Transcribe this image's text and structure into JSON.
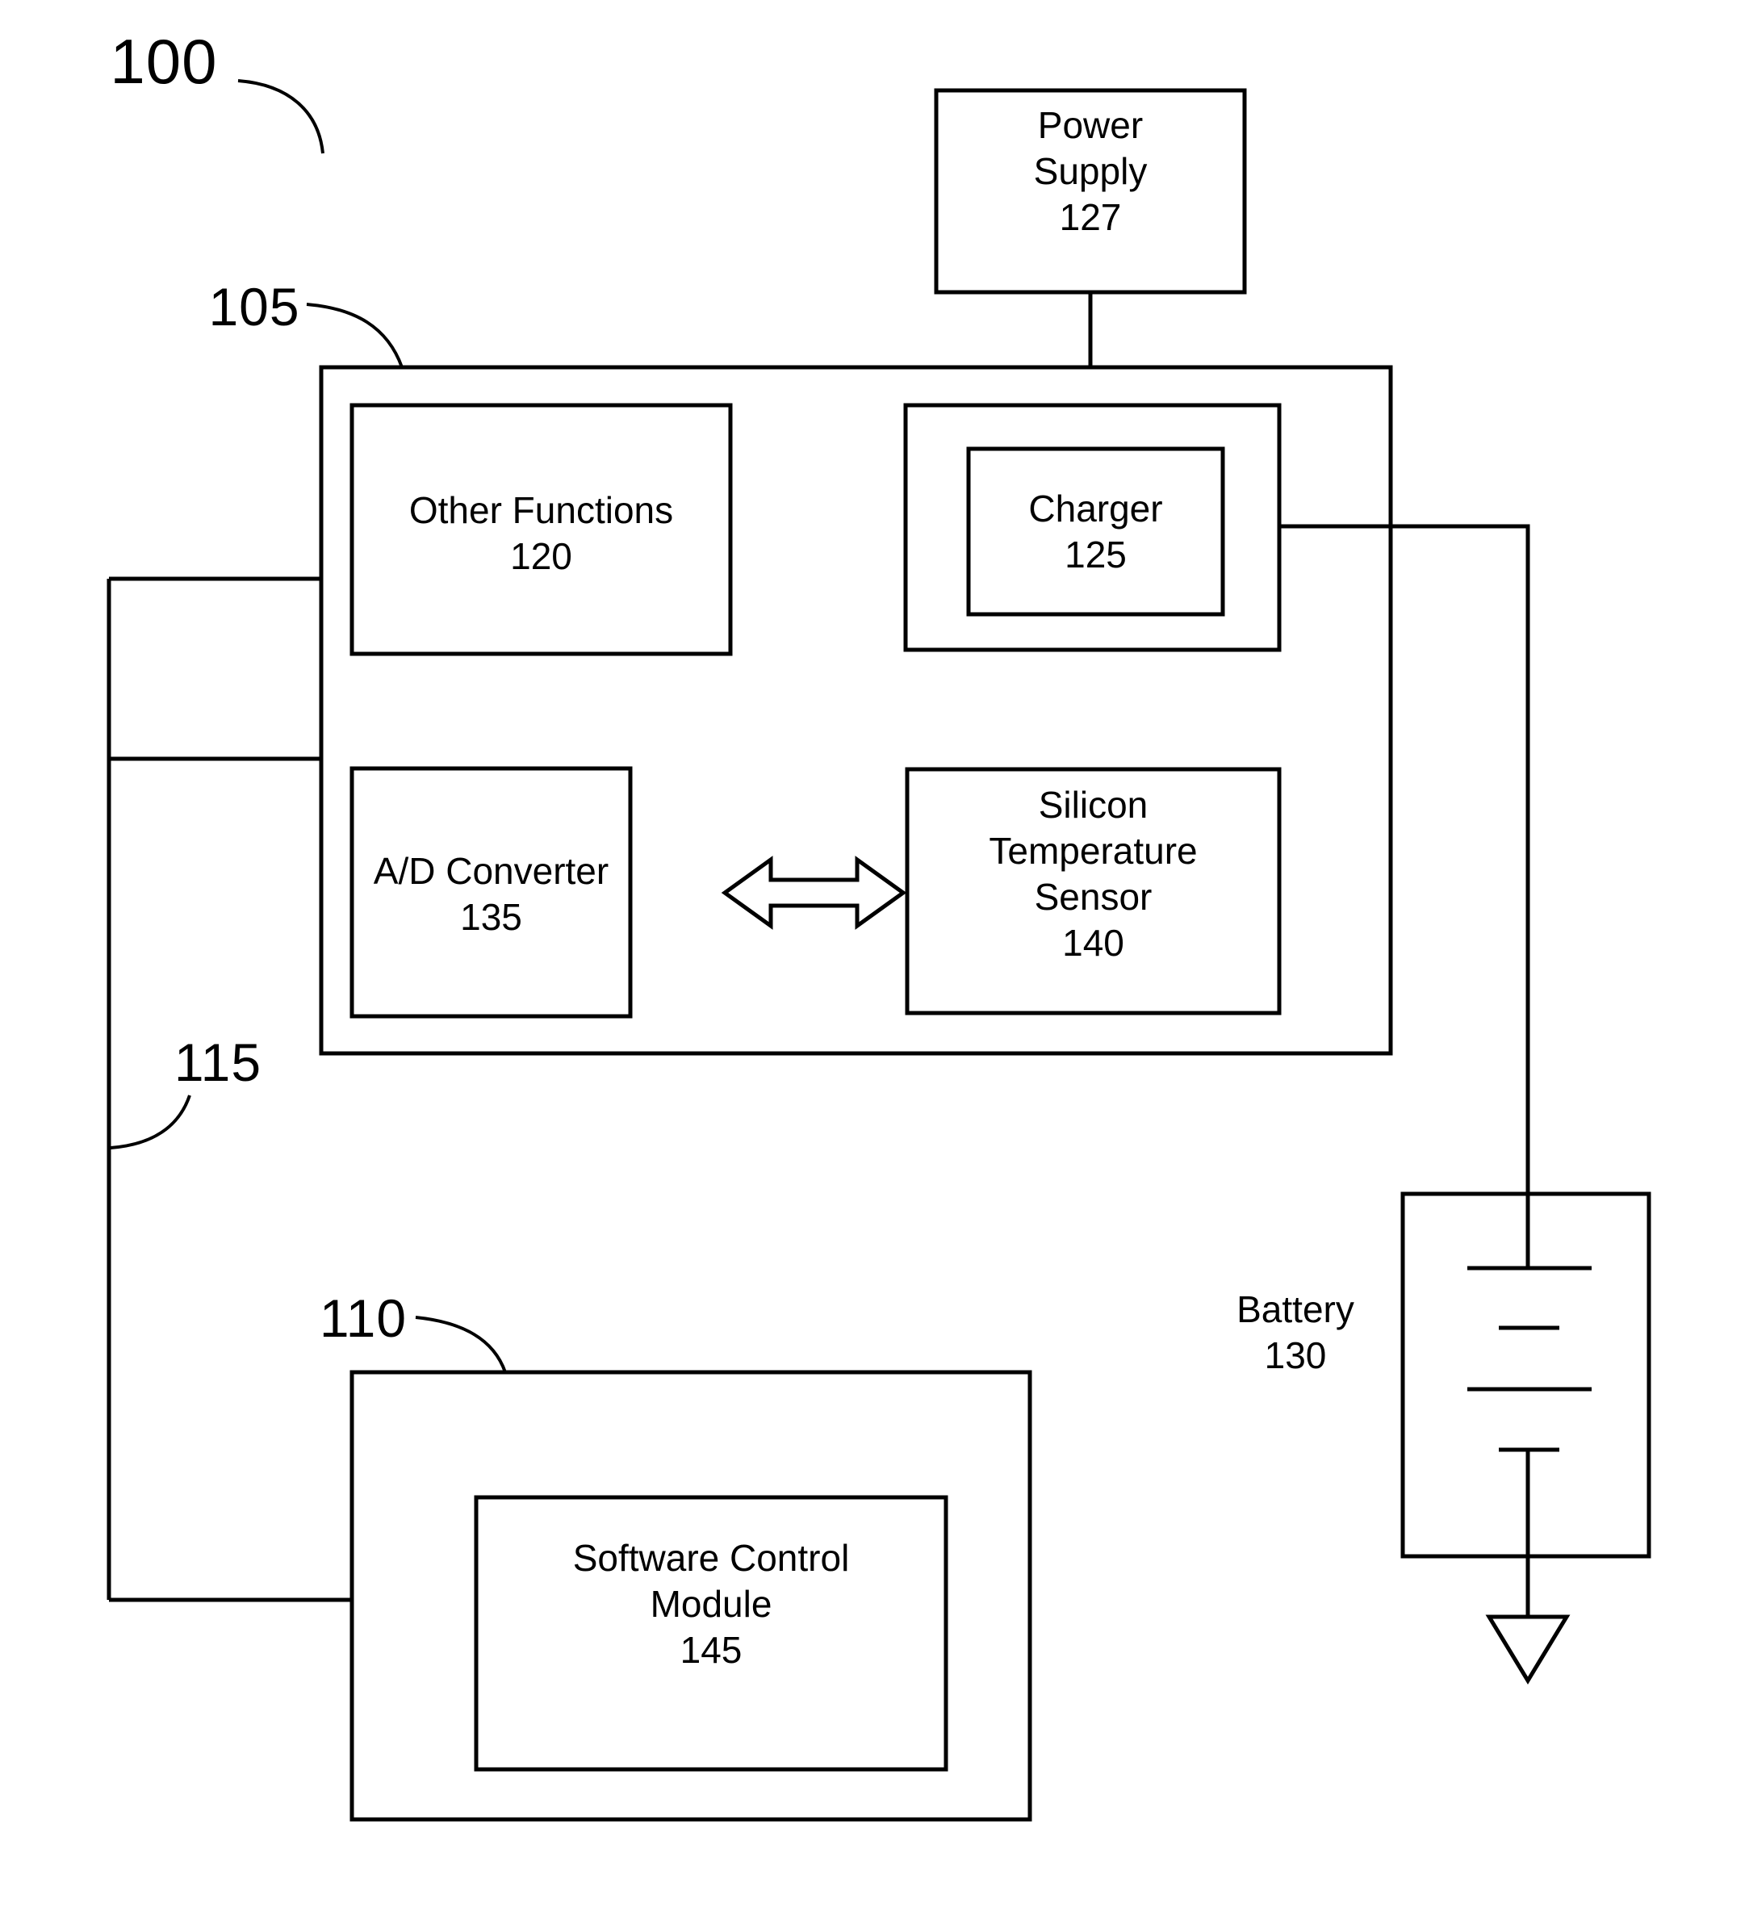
{
  "figure": {
    "type": "patent-block-diagram",
    "reference_numerals": {
      "system": "100",
      "device": "105",
      "host": "110",
      "bus": "115"
    }
  },
  "labels": {
    "system_100": "100",
    "device_105": "105",
    "host_110": "110",
    "bus_115": "115"
  },
  "blocks": {
    "power_supply": {
      "title": "Power\nSupply",
      "numeral": "127",
      "line1": "Power",
      "line2": "Supply",
      "line3": "127"
    },
    "other_functions": {
      "line1": "Other Functions",
      "line2": "120"
    },
    "charger": {
      "line1": "Charger",
      "line2": "125"
    },
    "ad_converter": {
      "line1": "A/D Converter",
      "line2": "135"
    },
    "temperature_sensor": {
      "line1": "Silicon",
      "line2": "Temperature",
      "line3": "Sensor",
      "line4": "140"
    },
    "software_control_module": {
      "line1": "Software Control",
      "line2": "Module",
      "line3": "145"
    },
    "battery": {
      "line1": "Battery",
      "line2": "130"
    }
  },
  "symbols": {
    "battery_cell": "battery-cell-symbol",
    "ground": "ground-triangle-symbol",
    "bidirectional_arrow": "double-headed-arrow"
  },
  "colors": {
    "stroke": "#000000",
    "background": "#ffffff"
  }
}
